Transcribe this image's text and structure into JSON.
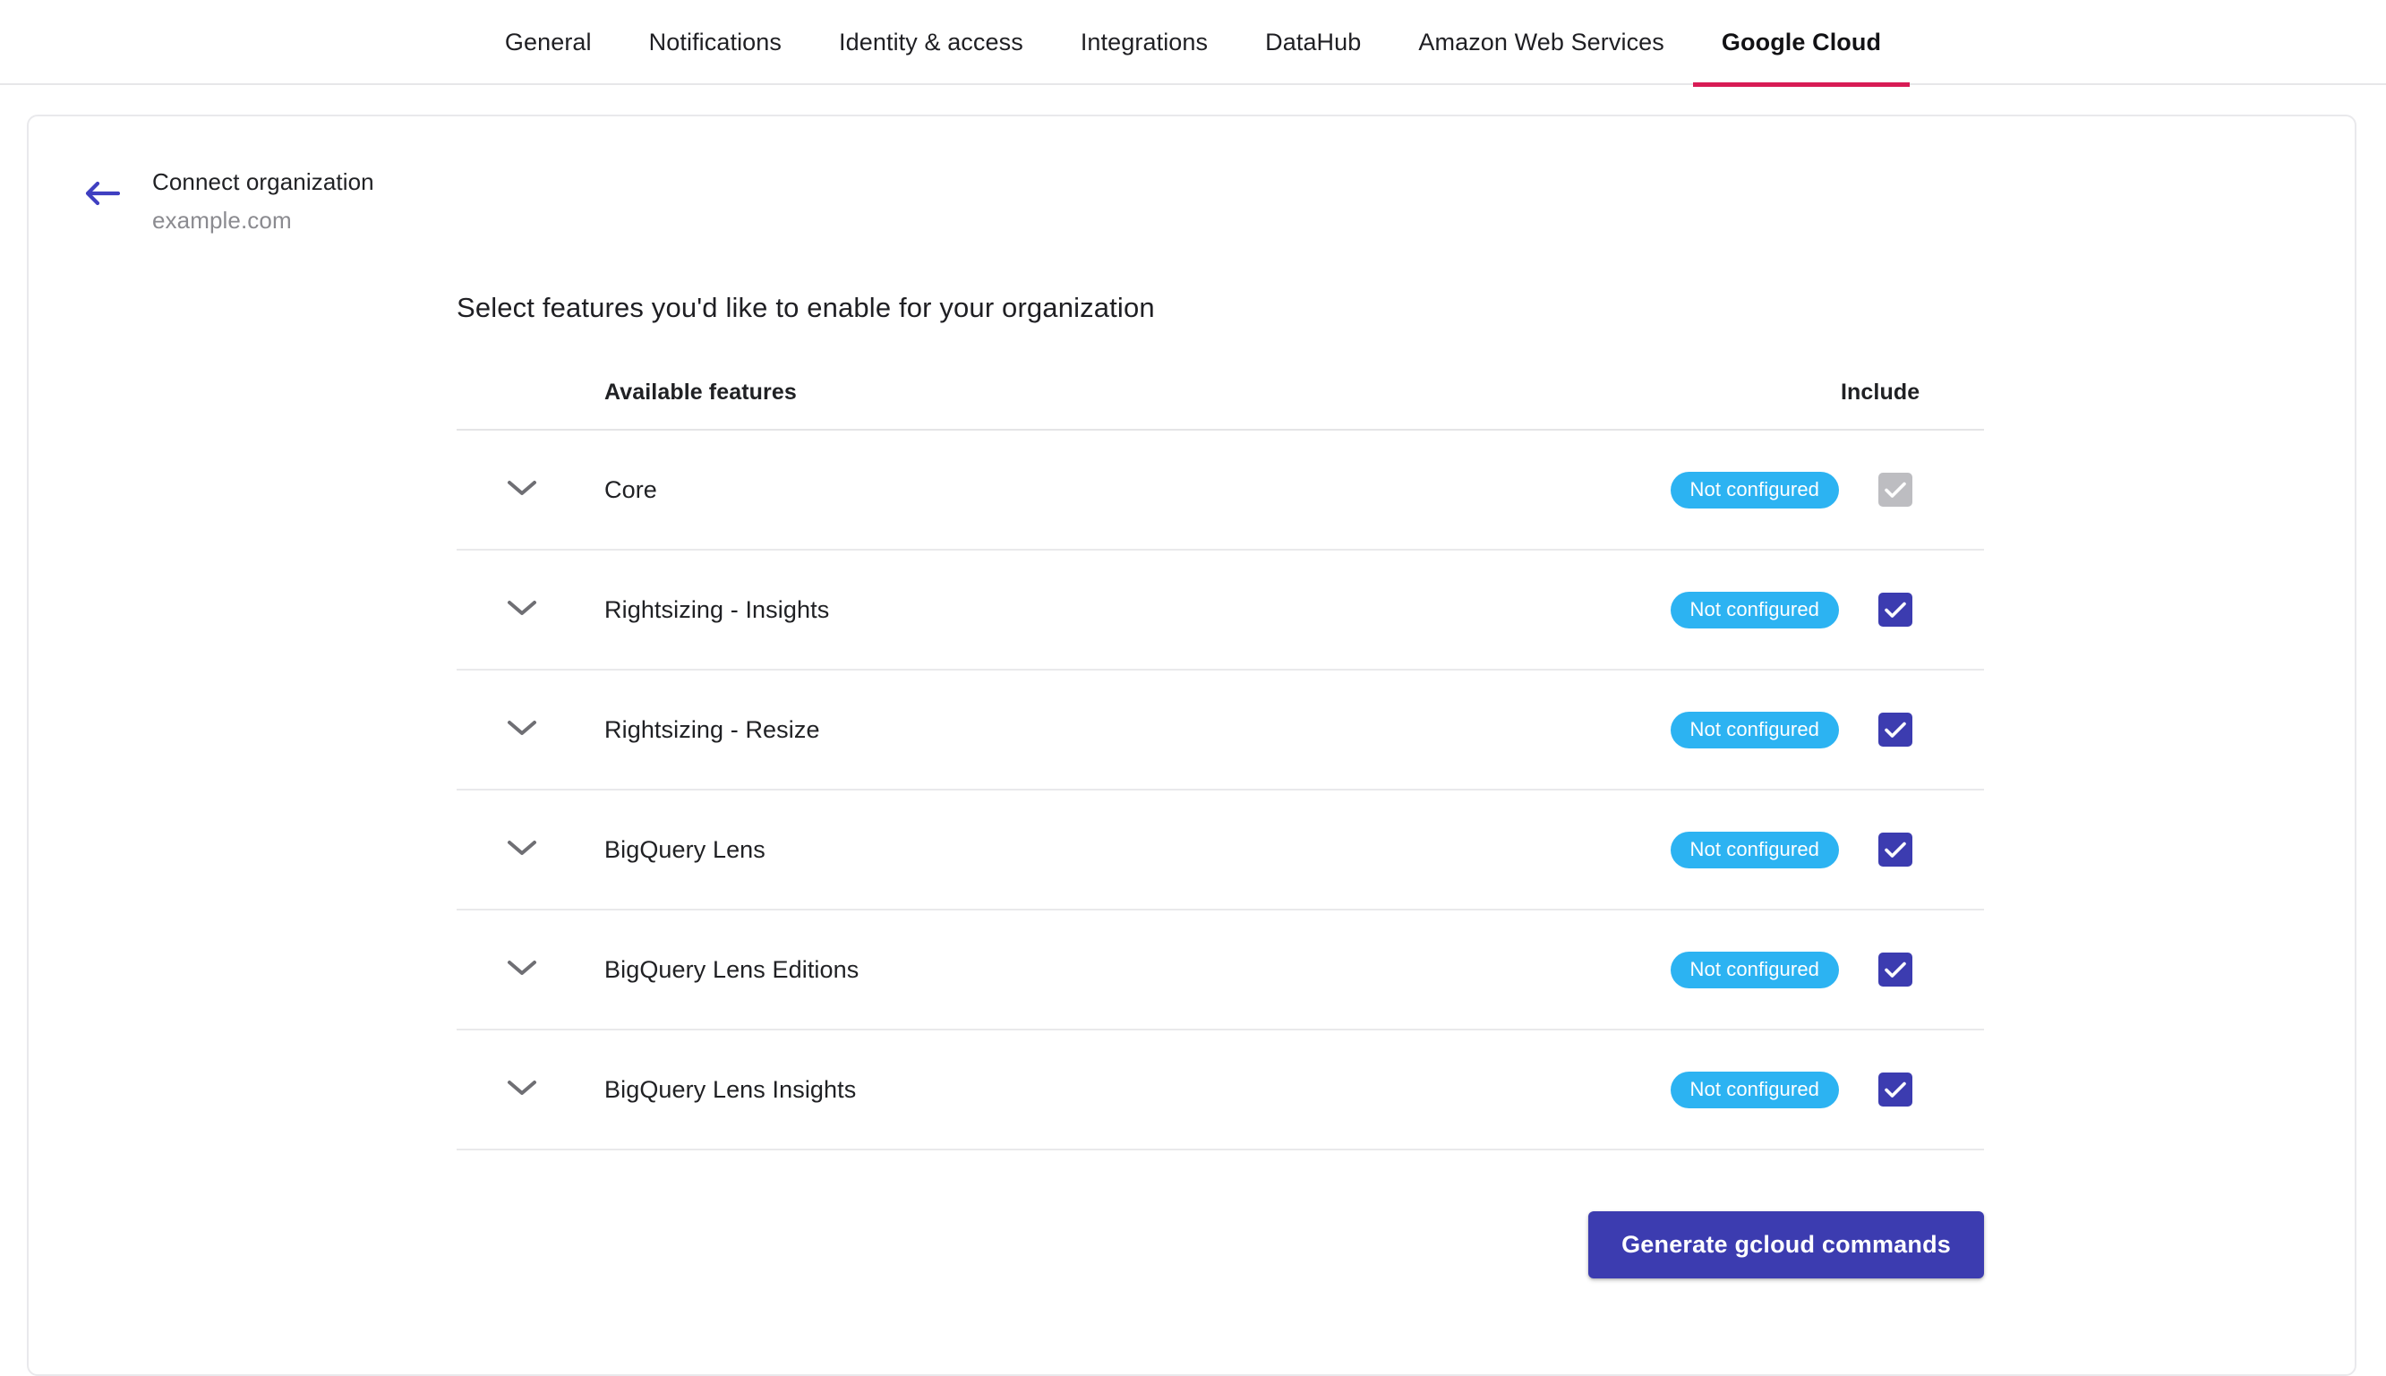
{
  "tabs": [
    {
      "label": "General",
      "active": false
    },
    {
      "label": "Notifications",
      "active": false
    },
    {
      "label": "Identity & access",
      "active": false
    },
    {
      "label": "Integrations",
      "active": false
    },
    {
      "label": "DataHub",
      "active": false
    },
    {
      "label": "Amazon Web Services",
      "active": false
    },
    {
      "label": "Google Cloud",
      "active": true
    }
  ],
  "header": {
    "back_icon": "arrow-left-icon",
    "title": "Connect organization",
    "subtitle": "example.com"
  },
  "main": {
    "section_title": "Select features you'd like to enable for your organization",
    "table": {
      "columns": {
        "feature": "Available features",
        "include": "Include"
      },
      "rows": [
        {
          "name": "Core",
          "status": "Not configured",
          "checked": true,
          "disabled": true,
          "expand_icon": "chevron-down-icon"
        },
        {
          "name": "Rightsizing - Insights",
          "status": "Not configured",
          "checked": true,
          "disabled": false,
          "expand_icon": "chevron-down-icon"
        },
        {
          "name": "Rightsizing - Resize",
          "status": "Not configured",
          "checked": true,
          "disabled": false,
          "expand_icon": "chevron-down-icon"
        },
        {
          "name": "BigQuery Lens",
          "status": "Not configured",
          "checked": true,
          "disabled": false,
          "expand_icon": "chevron-down-icon"
        },
        {
          "name": "BigQuery Lens Editions",
          "status": "Not configured",
          "checked": true,
          "disabled": false,
          "expand_icon": "chevron-down-icon"
        },
        {
          "name": "BigQuery Lens Insights",
          "status": "Not configured",
          "checked": true,
          "disabled": false,
          "expand_icon": "chevron-down-icon"
        }
      ]
    },
    "generate_button": "Generate gcloud commands"
  },
  "colors": {
    "active_tab_underline": "#d81b55",
    "accent_indigo": "#3c3cb0",
    "badge_blue": "#2cb3f2",
    "disabled_gray": "#bdbdc1",
    "text_primary": "#202124",
    "text_muted": "#8b8b90"
  }
}
